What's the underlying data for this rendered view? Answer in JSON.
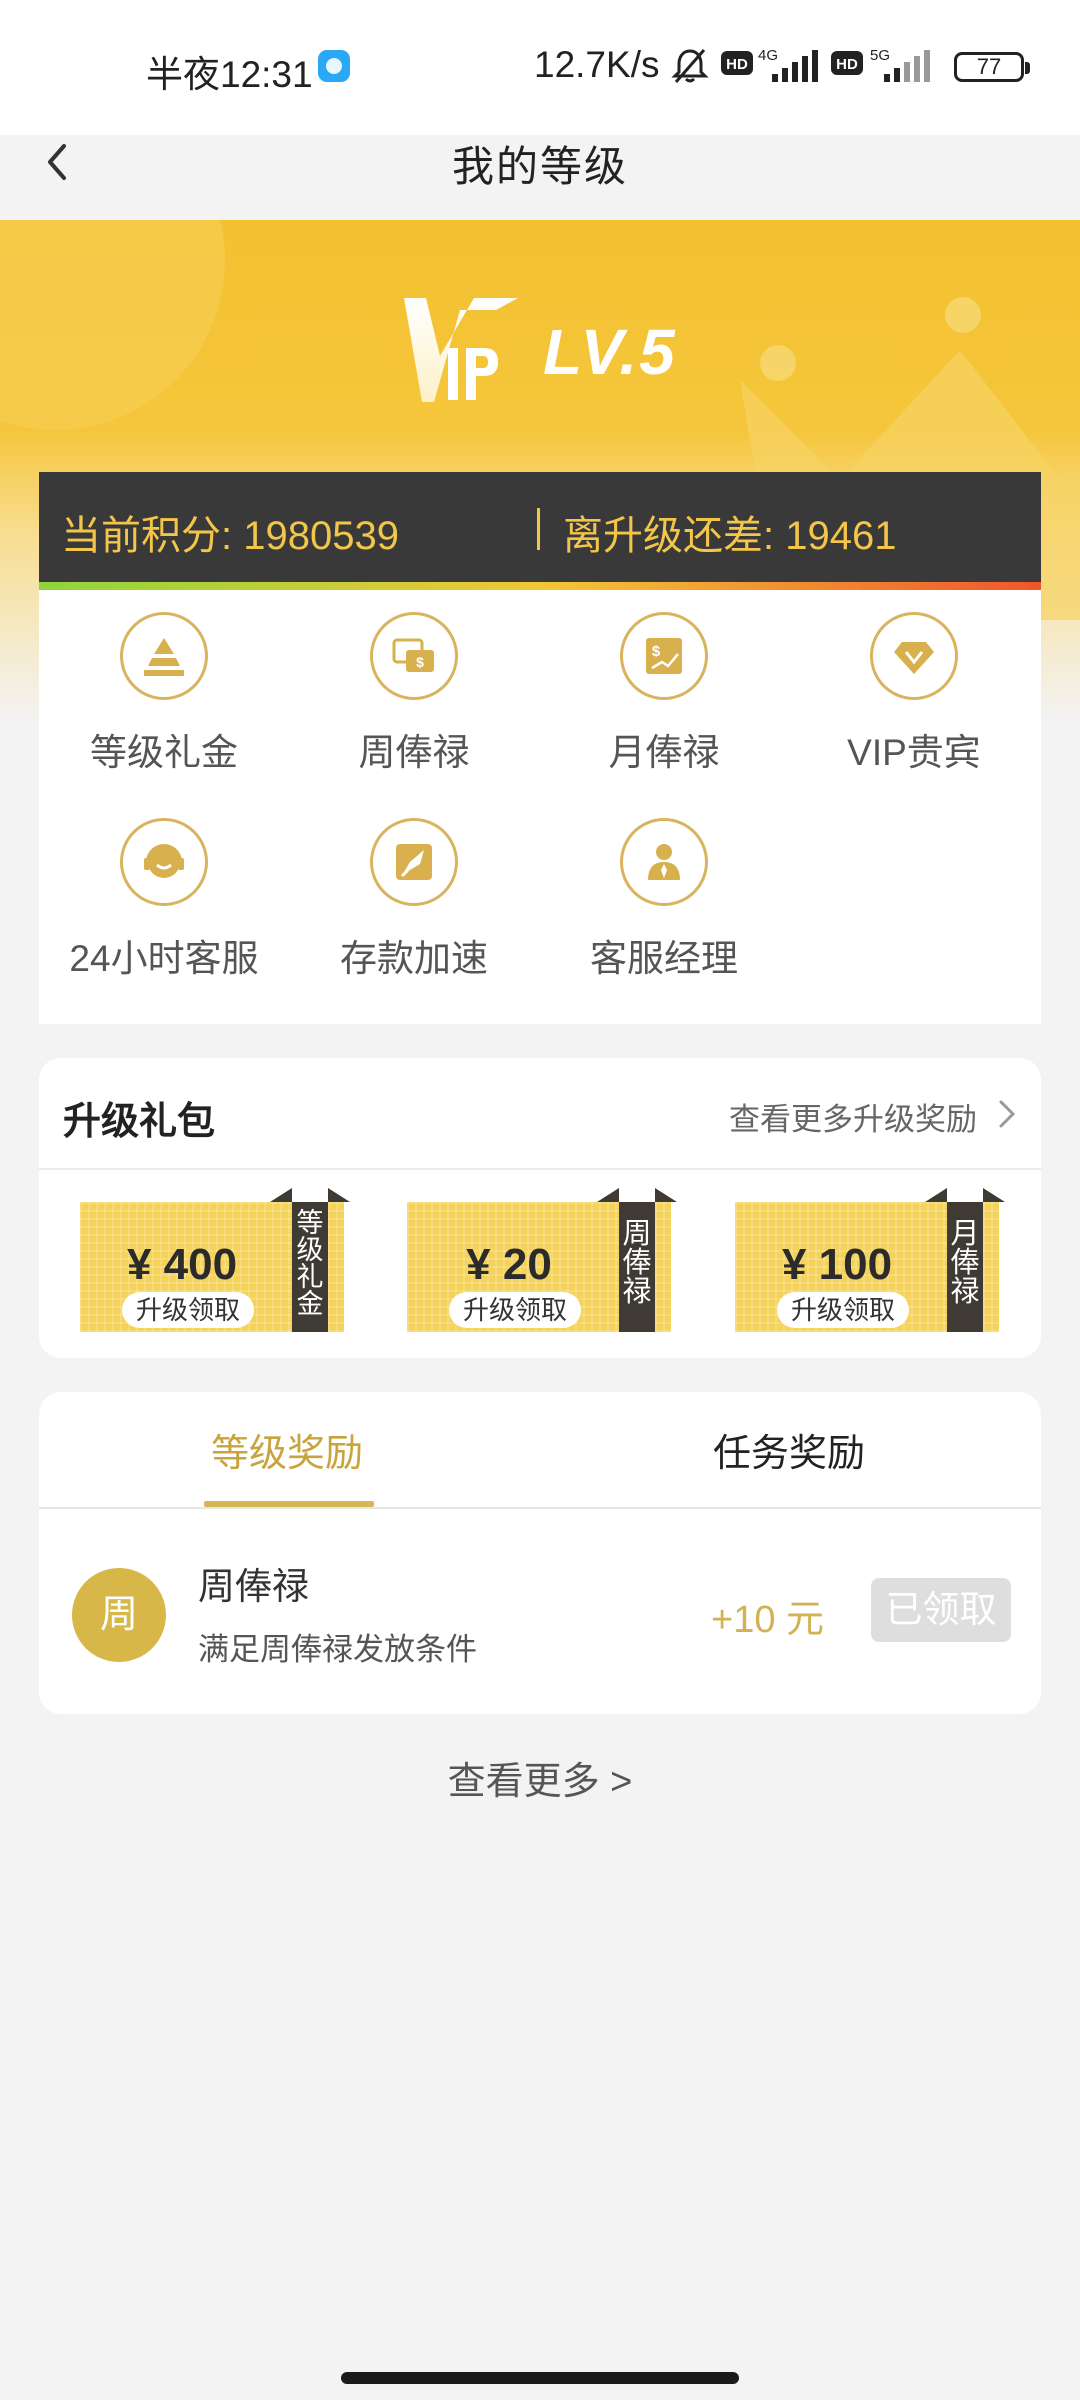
{
  "status_bar": {
    "time": "半夜12:31",
    "network_speed": "12.7K/s",
    "battery": "77",
    "signal1_label": "4G",
    "signal2_label": "5G",
    "hd_label": "HD"
  },
  "header": {
    "title": "我的等级"
  },
  "hero": {
    "vip_logo_text": "VIP",
    "level": "LV.5"
  },
  "points": {
    "current": "当前积分: 1980539",
    "to_upgrade": "离升级还差: 19461"
  },
  "privileges": [
    {
      "label": "等级礼金",
      "icon": "pyramid-icon"
    },
    {
      "label": "周俸禄",
      "icon": "money-card-icon"
    },
    {
      "label": "月俸禄",
      "icon": "dollar-chart-icon"
    },
    {
      "label": "VIP贵宾",
      "icon": "diamond-icon"
    },
    {
      "label": "24小时客服",
      "icon": "headset-icon"
    },
    {
      "label": "存款加速",
      "icon": "rocket-icon"
    },
    {
      "label": "客服经理",
      "icon": "manager-icon"
    }
  ],
  "upgrade_gift": {
    "title": "升级礼包",
    "more_link": "查看更多升级奖励",
    "coupons": [
      {
        "amount": "¥ 400",
        "action": "升级领取",
        "tag": "等级礼金"
      },
      {
        "amount": "¥ 20",
        "action": "升级领取",
        "tag": "周俸禄"
      },
      {
        "amount": "¥ 100",
        "action": "升级领取",
        "tag": "月俸禄"
      }
    ]
  },
  "rewards": {
    "tabs": [
      "等级奖励",
      "任务奖励"
    ],
    "active_tab": "等级奖励",
    "items": [
      {
        "avatar_char": "周",
        "name": "周俸禄",
        "description": "满足周俸禄发放条件",
        "amount": "+10 元",
        "status": "已领取"
      }
    ]
  },
  "see_more": "查看更多 >",
  "colors": {
    "brand_yellow": "#f4c12f",
    "gold": "#d2b253",
    "dark_bar": "#393939"
  }
}
